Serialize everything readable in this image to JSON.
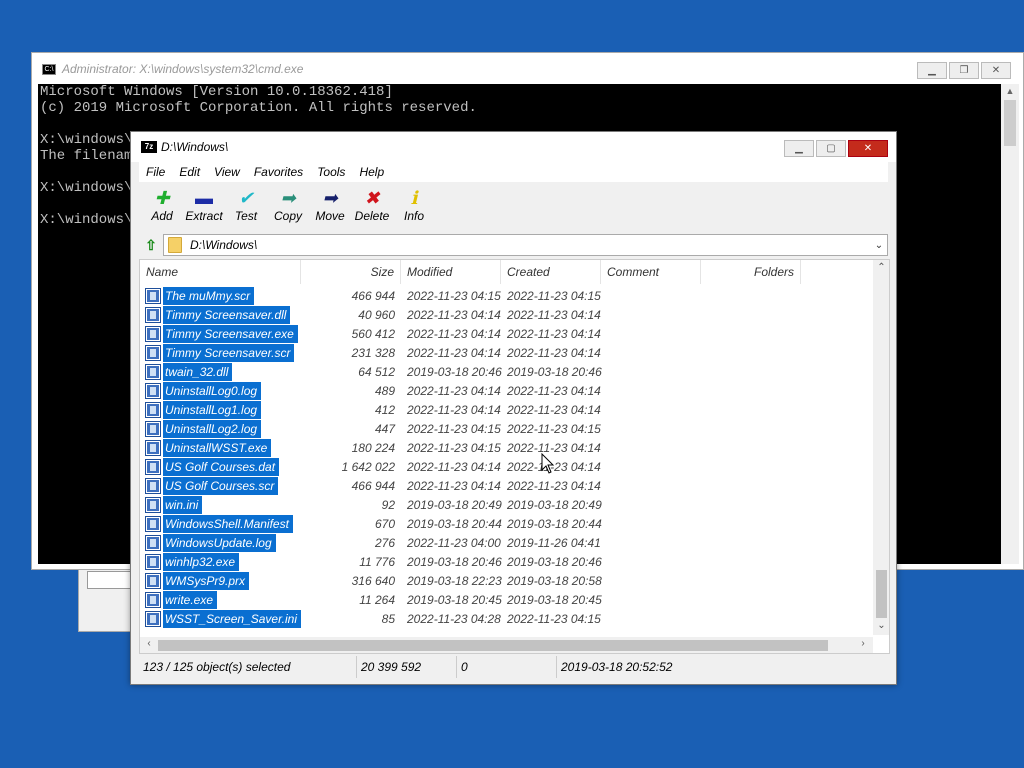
{
  "cmd": {
    "title": "Administrator: X:\\windows\\system32\\cmd.exe",
    "lines": [
      "Microsoft Windows [Version 10.0.18362.418]",
      "(c) 2019 Microsoft Corporation. All rights reserved.",
      "",
      "X:\\windows\\s",
      "The filename",
      "",
      "X:\\windows\\s",
      "",
      "X:\\windows\\s"
    ]
  },
  "zip": {
    "title": "D:\\Windows\\",
    "menu": [
      "File",
      "Edit",
      "View",
      "Favorites",
      "Tools",
      "Help"
    ],
    "toolbar": [
      {
        "label": "Add",
        "icon": "plus-icon",
        "color": "#1fae2e"
      },
      {
        "label": "Extract",
        "icon": "minus-icon",
        "color": "#1c2ca6"
      },
      {
        "label": "Test",
        "icon": "check-icon",
        "color": "#20b8c8"
      },
      {
        "label": "Copy",
        "icon": "copy-arrow-icon",
        "color": "#2a8f7a"
      },
      {
        "label": "Move",
        "icon": "move-arrow-icon",
        "color": "#16206b"
      },
      {
        "label": "Delete",
        "icon": "delete-x-icon",
        "color": "#d0141c"
      },
      {
        "label": "Info",
        "icon": "info-icon",
        "color": "#e0c000"
      }
    ],
    "path": "D:\\Windows\\",
    "columns": {
      "name": "Name",
      "size": "Size",
      "modified": "Modified",
      "created": "Created",
      "comment": "Comment",
      "folders": "Folders"
    },
    "files": [
      {
        "name": "The muMmy.scr",
        "size": "466 944",
        "modified": "2022-11-23 04:15",
        "created": "2022-11-23 04:15"
      },
      {
        "name": "Timmy Screensaver.dll",
        "size": "40 960",
        "modified": "2022-11-23 04:14",
        "created": "2022-11-23 04:14"
      },
      {
        "name": "Timmy Screensaver.exe",
        "size": "560 412",
        "modified": "2022-11-23 04:14",
        "created": "2022-11-23 04:14"
      },
      {
        "name": "Timmy Screensaver.scr",
        "size": "231 328",
        "modified": "2022-11-23 04:14",
        "created": "2022-11-23 04:14"
      },
      {
        "name": "twain_32.dll",
        "size": "64 512",
        "modified": "2019-03-18 20:46",
        "created": "2019-03-18 20:46"
      },
      {
        "name": "UninstallLog0.log",
        "size": "489",
        "modified": "2022-11-23 04:14",
        "created": "2022-11-23 04:14"
      },
      {
        "name": "UninstallLog1.log",
        "size": "412",
        "modified": "2022-11-23 04:14",
        "created": "2022-11-23 04:14"
      },
      {
        "name": "UninstallLog2.log",
        "size": "447",
        "modified": "2022-11-23 04:15",
        "created": "2022-11-23 04:15"
      },
      {
        "name": "UninstallWSST.exe",
        "size": "180 224",
        "modified": "2022-11-23 04:15",
        "created": "2022-11-23 04:14"
      },
      {
        "name": "US Golf Courses.dat",
        "size": "1 642 022",
        "modified": "2022-11-23 04:14",
        "created": "2022-11-23 04:14"
      },
      {
        "name": "US Golf Courses.scr",
        "size": "466 944",
        "modified": "2022-11-23 04:14",
        "created": "2022-11-23 04:14"
      },
      {
        "name": "win.ini",
        "size": "92",
        "modified": "2019-03-18 20:49",
        "created": "2019-03-18 20:49"
      },
      {
        "name": "WindowsShell.Manifest",
        "size": "670",
        "modified": "2019-03-18 20:44",
        "created": "2019-03-18 20:44"
      },
      {
        "name": "WindowsUpdate.log",
        "size": "276",
        "modified": "2022-11-23 04:00",
        "created": "2019-11-26 04:41"
      },
      {
        "name": "winhlp32.exe",
        "size": "11 776",
        "modified": "2019-03-18 20:46",
        "created": "2019-03-18 20:46"
      },
      {
        "name": "WMSysPr9.prx",
        "size": "316 640",
        "modified": "2019-03-18 22:23",
        "created": "2019-03-18 20:58"
      },
      {
        "name": "write.exe",
        "size": "11 264",
        "modified": "2019-03-18 20:45",
        "created": "2019-03-18 20:45"
      },
      {
        "name": "WSST_Screen_Saver.ini",
        "size": "85",
        "modified": "2022-11-23 04:28",
        "created": "2022-11-23 04:15"
      }
    ],
    "status": {
      "selection": "123 / 125 object(s) selected",
      "total_size": "20 399 592",
      "second": "0",
      "date": "2019-03-18 20:52:52"
    }
  },
  "colors": {
    "desktop": "#1a5fb4",
    "selection": "#0a6fd1",
    "close": "#c42b1c"
  }
}
